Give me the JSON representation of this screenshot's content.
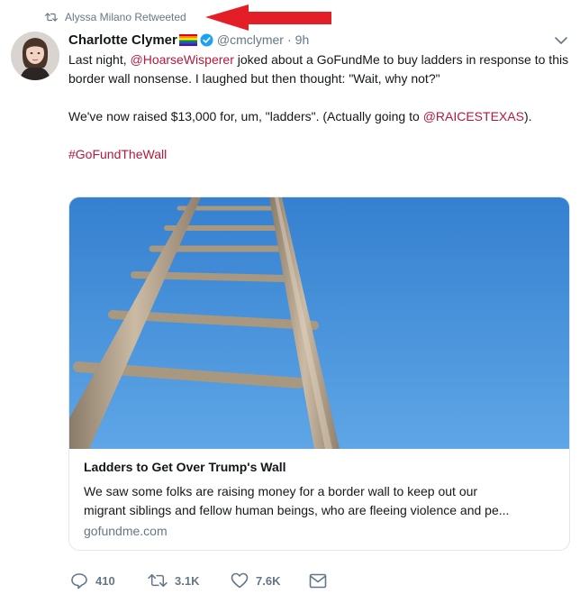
{
  "retweet": {
    "text": "Alyssa Milano Retweeted"
  },
  "tweet": {
    "author_name": "Charlotte Clymer",
    "handle": "@cmclymer",
    "separator": "·",
    "time": "9h",
    "body": {
      "p1_pre": "Last night, ",
      "p1_mention": "@HoarseWisperer",
      "p1_post": " joked about a GoFundMe to buy ladders in response to this border wall nonsense. I laughed but then thought: \"Wait, why not?\"",
      "p2_pre": "We've now raised $13,000 for, um, \"ladders\". (Actually going to ",
      "p2_mention": "@RAICESTEXAS",
      "p2_post": ").",
      "hashtag": "#GoFundTheWall"
    }
  },
  "card": {
    "title": "Ladders to Get Over Trump's Wall",
    "desc_line1": "We saw some folks are raising money for a border wall to keep out our",
    "desc_line2": "migrant siblings and fellow human beings, who are fleeing violence and pe...",
    "domain": "gofundme.com"
  },
  "actions": {
    "replies": "410",
    "retweets": "3.1K",
    "likes": "7.6K"
  },
  "colors": {
    "link": "#b3193c",
    "muted": "#657786",
    "verified": "#1da1f2",
    "arrow": "#e41e26",
    "sky": "#3f8fd6"
  },
  "icons": [
    "retweet-icon",
    "rainbow-flag-icon",
    "verified-icon",
    "chevron-down-icon",
    "reply-icon",
    "like-icon",
    "dm-icon"
  ]
}
